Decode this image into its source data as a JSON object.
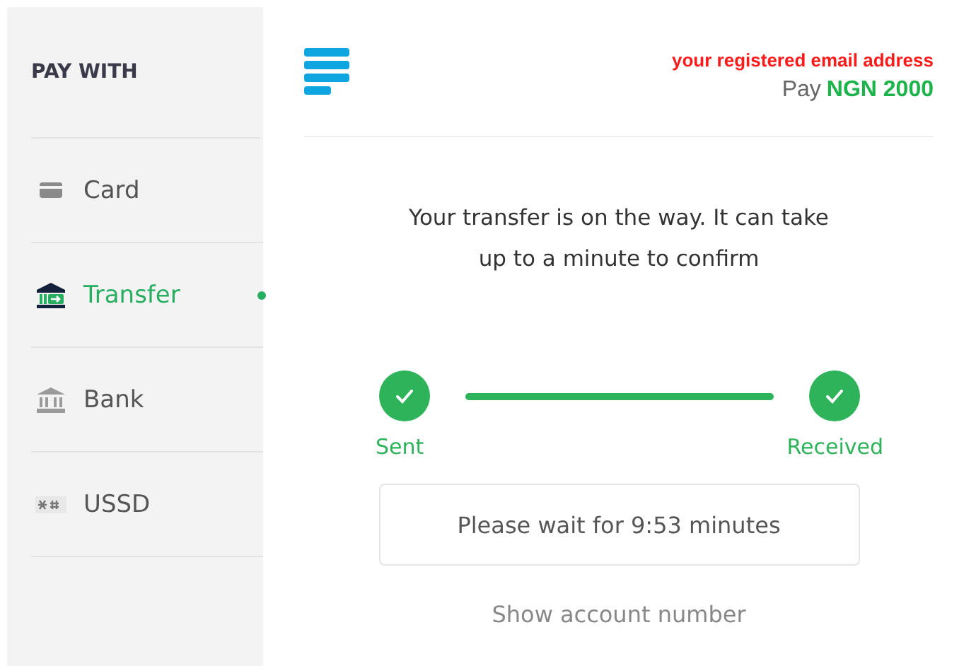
{
  "sidebar": {
    "heading": "PAY WITH",
    "items": [
      {
        "label": "Card",
        "kind": "card",
        "selected": false
      },
      {
        "label": "Transfer",
        "kind": "transfer",
        "selected": true
      },
      {
        "label": "Bank",
        "kind": "bank",
        "selected": false
      },
      {
        "label": "USSD",
        "kind": "ussd",
        "selected": false
      }
    ]
  },
  "header": {
    "email": "your registered email address",
    "pay_label": "Pay",
    "amount": "NGN 2000"
  },
  "message": "Your transfer is on the way. It can take up to a minute to confirm",
  "steps": [
    {
      "label": "Sent",
      "done": true
    },
    {
      "label": "Received",
      "done": true
    }
  ],
  "progress": {
    "level": 1
  },
  "wait_notice": "Please wait for 9:53 minutes",
  "link": "Show account number"
}
